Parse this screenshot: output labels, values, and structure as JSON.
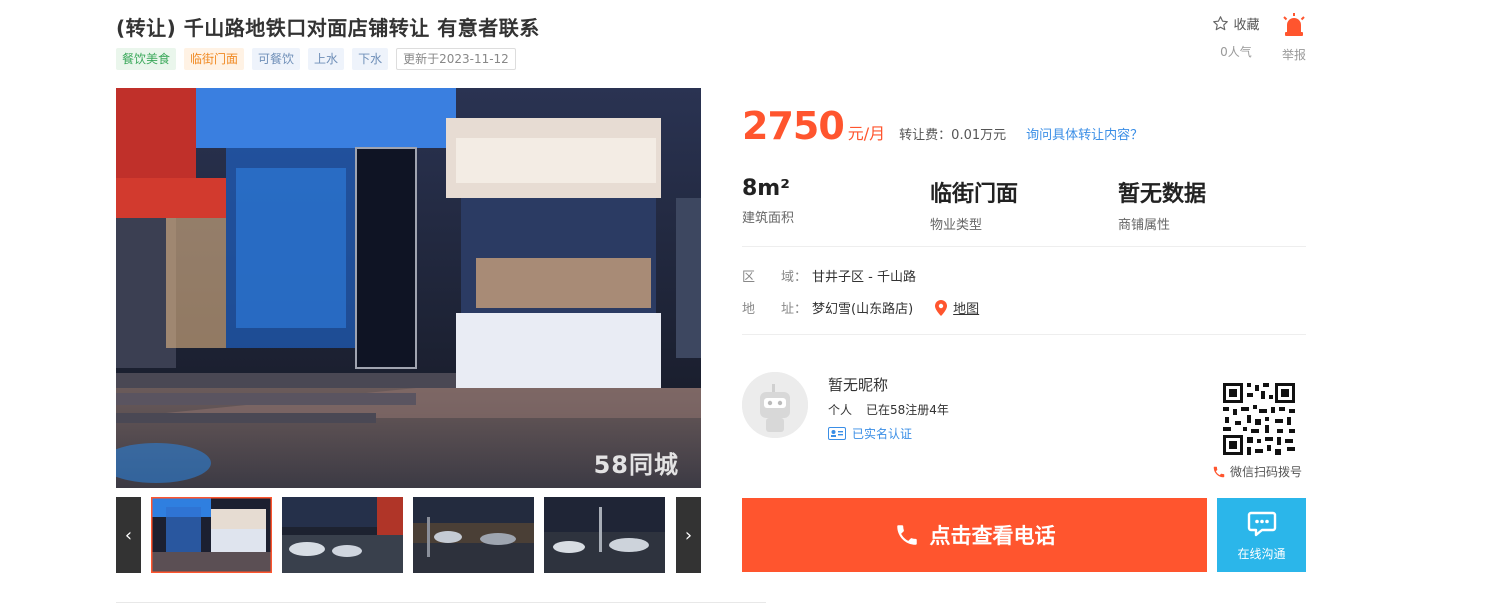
{
  "title": "(转让) 千山路地铁口对面店铺转让 有意者联系",
  "tags": [
    "餐饮美食",
    "临街门面",
    "可餐饮",
    "上水",
    "下水"
  ],
  "update_label": "更新于2023-11-12",
  "actions": {
    "favorite_label": "收藏",
    "popularity": "0人气",
    "report_label": "举报"
  },
  "gallery": {
    "watermark": "58同城",
    "prev_icon": "chevron-left-icon",
    "next_icon": "chevron-right-icon"
  },
  "price": {
    "amount": "2750",
    "unit": "元/月",
    "transfer_fee": "转让费：0.01万元",
    "inquiry_link": "询问具体转让内容？"
  },
  "stats": [
    {
      "value": "8m²",
      "label": "建筑面积"
    },
    {
      "value": "临街门面",
      "label": "物业类型"
    },
    {
      "value": "暂无数据",
      "label": "商铺属性"
    }
  ],
  "location": {
    "area_key": "区　　域：",
    "area_value": "甘井子区 - 千山路",
    "address_key": "地　　址：",
    "address_value": "梦幻雪(山东路店)",
    "map_link": "地图"
  },
  "poster": {
    "name": "暂无昵称",
    "type": "个人",
    "registered": "已在58注册4年",
    "verified": "已实名认证"
  },
  "qr_caption": "微信扫码拨号",
  "call_button": "点击查看电话",
  "chat_button": "在线沟通",
  "colors": {
    "accent": "#ff552e",
    "link": "#3a8ee6",
    "chat": "#2bb6ea"
  }
}
